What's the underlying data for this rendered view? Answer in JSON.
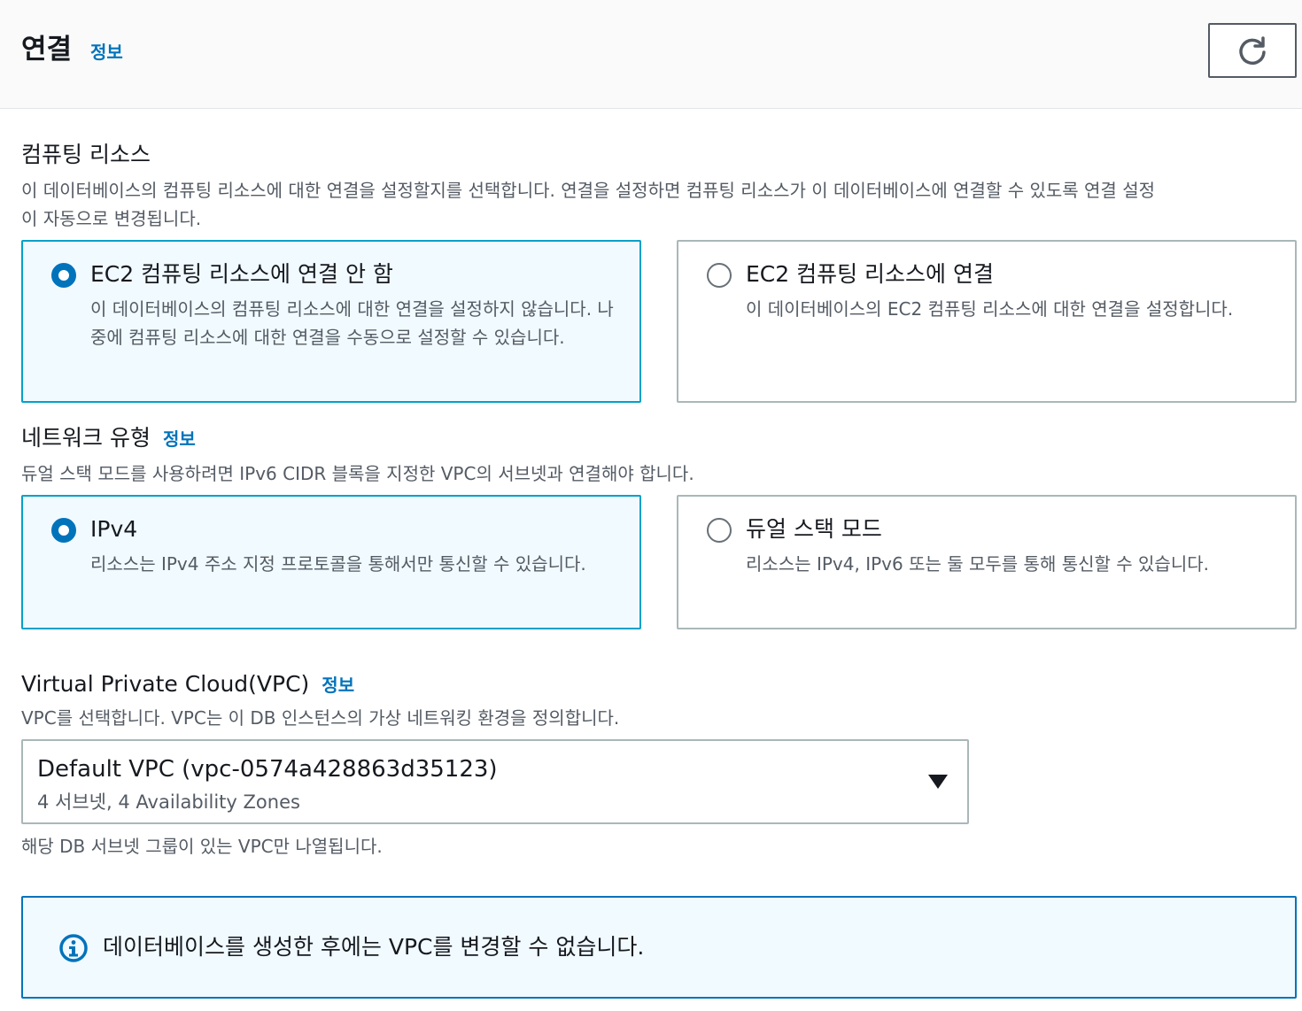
{
  "header": {
    "title": "연결",
    "info_label": "정보",
    "refresh_icon": "refresh-icon"
  },
  "compute": {
    "label": "컴퓨팅 리소스",
    "description_line1": "이 데이터베이스의 컴퓨팅 리소스에 대한 연결을 설정할지를 선택합니다. 연결을 설정하면 컴퓨팅 리소스가 이 데이터베이스에 연결할 수 있도록 연결 설정",
    "description_line2": "이 자동으로 변경됩니다.",
    "options": [
      {
        "title": "EC2 컴퓨팅 리소스에 연결 안 함",
        "description": "이 데이터베이스의 컴퓨팅 리소스에 대한 연결을 설정하지 않습니다. 나중에 컴퓨팅 리소스에 대한 연결을 수동으로 설정할 수 있습니다.",
        "selected": true
      },
      {
        "title": "EC2 컴퓨팅 리소스에 연결",
        "description": "이 데이터베이스의 EC2 컴퓨팅 리소스에 대한 연결을 설정합니다.",
        "selected": false
      }
    ]
  },
  "network": {
    "label": "네트워크 유형",
    "info_label": "정보",
    "description": "듀얼 스택 모드를 사용하려면 IPv6 CIDR 블록을 지정한 VPC의 서브넷과 연결해야 합니다.",
    "options": [
      {
        "title": "IPv4",
        "description": "리소스는 IPv4 주소 지정 프로토콜을 통해서만 통신할 수 있습니다.",
        "selected": true
      },
      {
        "title": "듀얼 스택 모드",
        "description": "리소스는 IPv4, IPv6 또는 둘 모두를 통해 통신할 수 있습니다.",
        "selected": false
      }
    ]
  },
  "vpc": {
    "label": "Virtual Private Cloud(VPC)",
    "info_label": "정보",
    "description": "VPC를 선택합니다. VPC는 이 DB 인스턴스의 가상 네트워킹 환경을 정의합니다.",
    "selected_value": "Default VPC (vpc-0574a428863d35123)",
    "selected_sub": "4 서브넷, 4 Availability Zones",
    "hint": "해당 DB 서브넷 그룹이 있는 VPC만 나열됩니다."
  },
  "alert": {
    "icon": "info-icon",
    "text": "데이터베이스를 생성한 후에는 VPC를 변경할 수 없습니다."
  },
  "colors": {
    "accent": "#0073bb",
    "selected_border": "#00a1c9",
    "selected_bg": "#f1faff",
    "muted_text": "#545b64"
  }
}
